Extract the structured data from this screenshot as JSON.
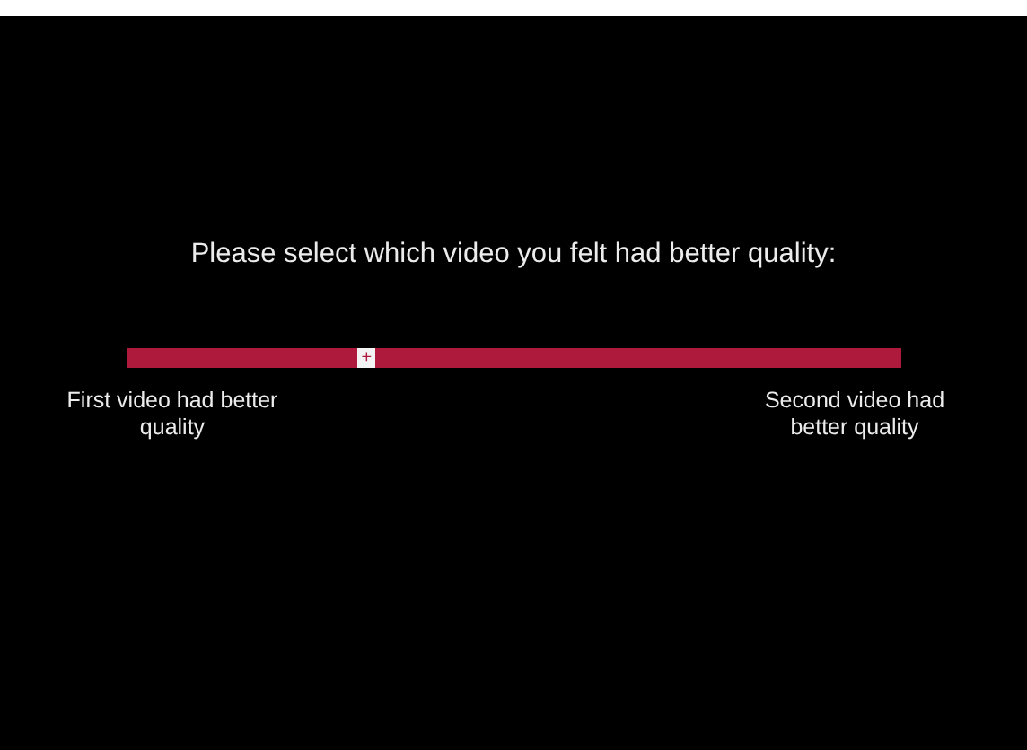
{
  "prompt": "Please select which video you felt had better quality:",
  "slider": {
    "level": 0.31,
    "left_label": "First video had better quality",
    "right_label": "Second video had better quality",
    "thumb_symbol": "+"
  }
}
